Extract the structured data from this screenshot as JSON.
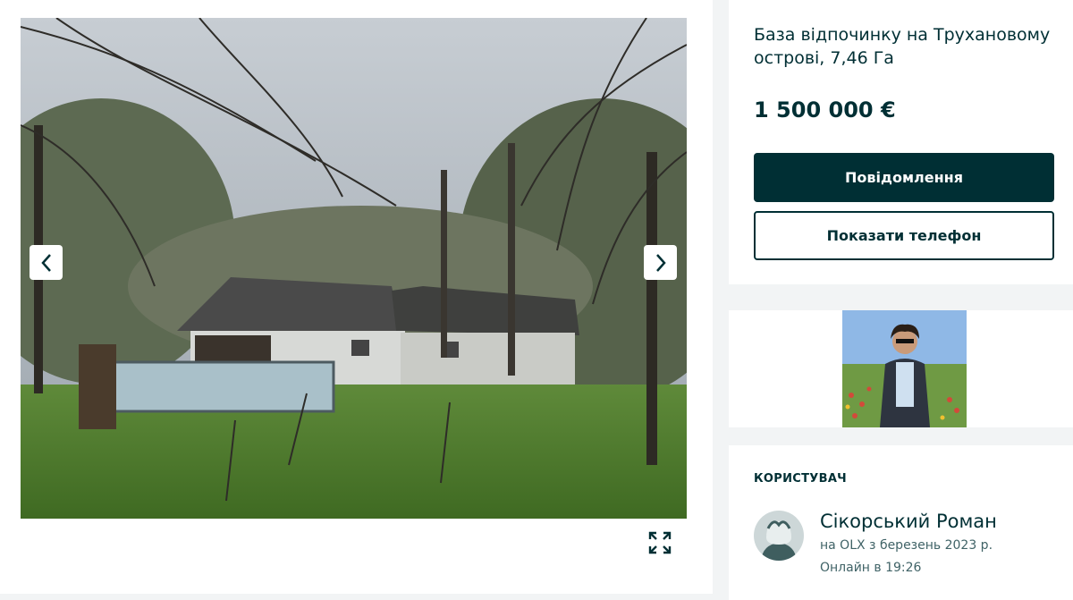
{
  "listing": {
    "title": "База відпочинку на Трухановому острові, 7,46 Га",
    "price": "1 500 000 €"
  },
  "actions": {
    "message_label": "Повідомлення",
    "show_phone_label": "Показати телефон"
  },
  "gallery": {
    "prev_icon": "chevron-left-icon",
    "next_icon": "chevron-right-icon",
    "fullscreen_icon": "expand-icon"
  },
  "user": {
    "heading": "КОРИСТУВАЧ",
    "name": "Сікорський Роман",
    "since": "на OLX з березень 2023 р.",
    "online": "Онлайн в 19:26"
  },
  "colors": {
    "primary": "#002f34",
    "page_background": "#f2f4f5",
    "card_background": "#ffffff"
  }
}
